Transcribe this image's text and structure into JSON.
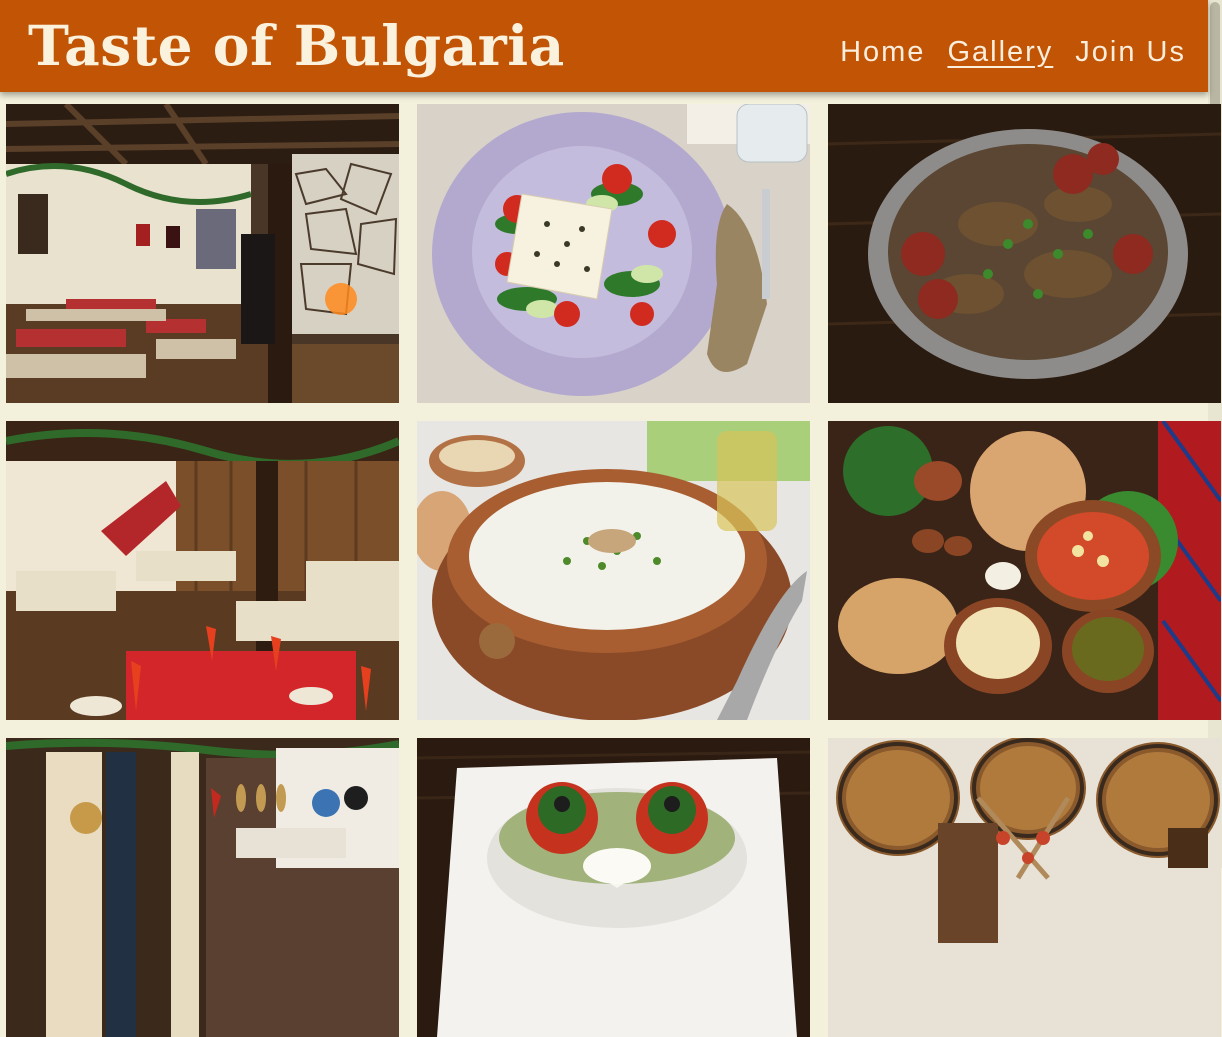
{
  "site": {
    "title": "Taste of Bulgaria"
  },
  "nav": {
    "items": [
      {
        "label": "Home",
        "active": false
      },
      {
        "label": "Gallery",
        "active": true
      },
      {
        "label": "Join Us",
        "active": false
      }
    ]
  },
  "gallery": {
    "photos": [
      {
        "subject": "rustic restaurant interior with stone wall and red tablecloths"
      },
      {
        "subject": "shopska salad with white cheese on a lavender plate"
      },
      {
        "subject": "sausage and meat stew in metal pan"
      },
      {
        "subject": "festive tavern dining room with red napkins"
      },
      {
        "subject": "tarator cold yogurt cucumber soup in clay bowl"
      },
      {
        "subject": "traditional spread with flatbread and clay pots"
      },
      {
        "subject": "restaurant interior with curtains and decorated plates"
      },
      {
        "subject": "stuffed tomatoes with cheese on white plate"
      },
      {
        "subject": "wine barrels with skewers"
      }
    ]
  },
  "colors": {
    "header_bg": "#c25405",
    "page_bg": "#f3f1dc",
    "header_text": "#fbf2de"
  }
}
